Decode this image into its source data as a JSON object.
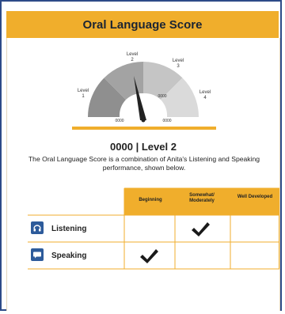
{
  "header": {
    "title": "Oral Language Score"
  },
  "gauge": {
    "level_label": "Level",
    "levels": [
      "1",
      "2",
      "3",
      "4"
    ],
    "inner_values": [
      "0000",
      "0000"
    ],
    "base_values": [
      "0000",
      "0000"
    ],
    "needle_level": 2,
    "colors": {
      "dark": "#8f8f8f",
      "mid": "#b7b7b7",
      "light": "#d8d8d8",
      "accent": "#f0ae2c",
      "needle": "#222222"
    }
  },
  "score": {
    "value": "0000",
    "separator": "|",
    "level": "Level 2"
  },
  "description": "The Oral Language Score is a combination of Anita's Listening and Speaking performance, shown below.",
  "matrix": {
    "columns": [
      "Beginning",
      "Somewhat/ Moderately",
      "Well Developed"
    ],
    "rows": [
      {
        "label": "Listening",
        "icon": "headphones-icon",
        "checked_column": 1
      },
      {
        "label": "Speaking",
        "icon": "speech-bubble-icon",
        "checked_column": 0
      }
    ],
    "colors": {
      "header_bg": "#f0ae2c",
      "icon_bg": "#2d5b9b",
      "grid": "#f0ae2c"
    }
  }
}
